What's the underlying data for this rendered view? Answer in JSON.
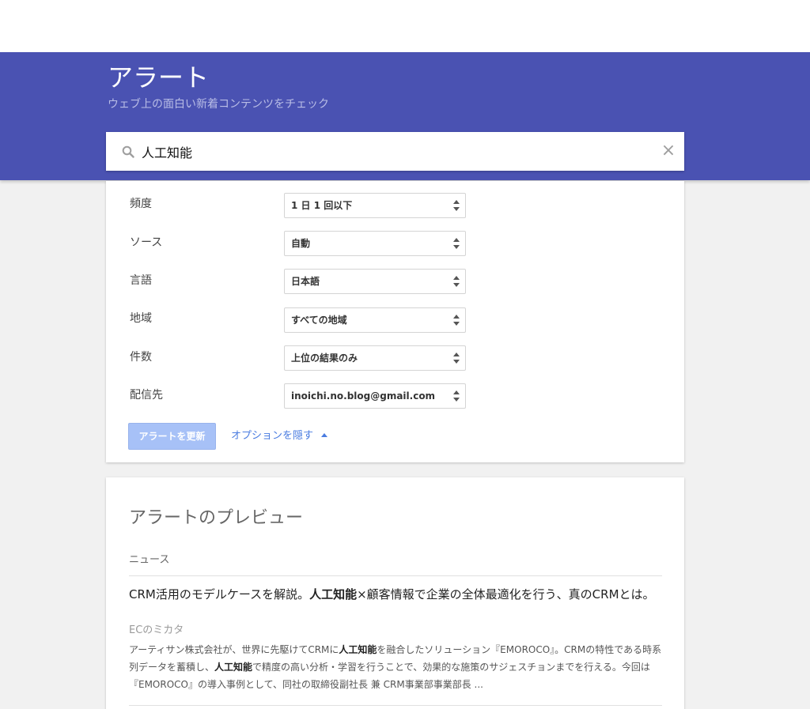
{
  "header": {
    "title": "アラート",
    "subtitle": "ウェブ上の面白い新着コンテンツをチェック"
  },
  "search": {
    "value": "人工知能",
    "clear_icon": "×"
  },
  "options": [
    {
      "label": "頻度",
      "value": "1 日 1 回以下"
    },
    {
      "label": "ソース",
      "value": "自動"
    },
    {
      "label": "言語",
      "value": "日本語"
    },
    {
      "label": "地域",
      "value": "すべての地域"
    },
    {
      "label": "件数",
      "value": "上位の結果のみ"
    },
    {
      "label": "配信先",
      "value": "inoichi.no.blog@gmail.com"
    }
  ],
  "actions": {
    "update_label": "アラートを更新",
    "hide_options_label": "オプションを隠す"
  },
  "preview": {
    "title": "アラートのプレビュー",
    "section": "ニュース",
    "item": {
      "title_pre": "CRM活用のモデルケースを解説。",
      "title_bold": "人工知能",
      "title_post": "×顧客情報で企業の全体最適化を行う、真のCRMとは。",
      "source": "ECのミカタ",
      "snippet_1": "アーティサン株式会社が、世界に先駆けてCRMに",
      "snippet_bold_1": "人工知能",
      "snippet_2": "を融合したソリューション『EMOROCO』。CRMの特性である時系列データを蓄積し、",
      "snippet_bold_2": "人工知能",
      "snippet_3": "で精度の高い分析・学習を行うことで、効果的な施策のサジェスチョンまでを行える。今回は『EMOROCO』の導入事例として、同社の取締役副社長 兼 CRM事業部事業部長 ..."
    }
  },
  "colors": {
    "banner": "#4a52b2",
    "button": "#a7c1f7",
    "link": "#4a7ce0"
  },
  "icons": {
    "search": "search-icon",
    "clear": "close-icon",
    "select_arrows": "sort-arrows-icon",
    "caret": "caret-up-icon"
  }
}
